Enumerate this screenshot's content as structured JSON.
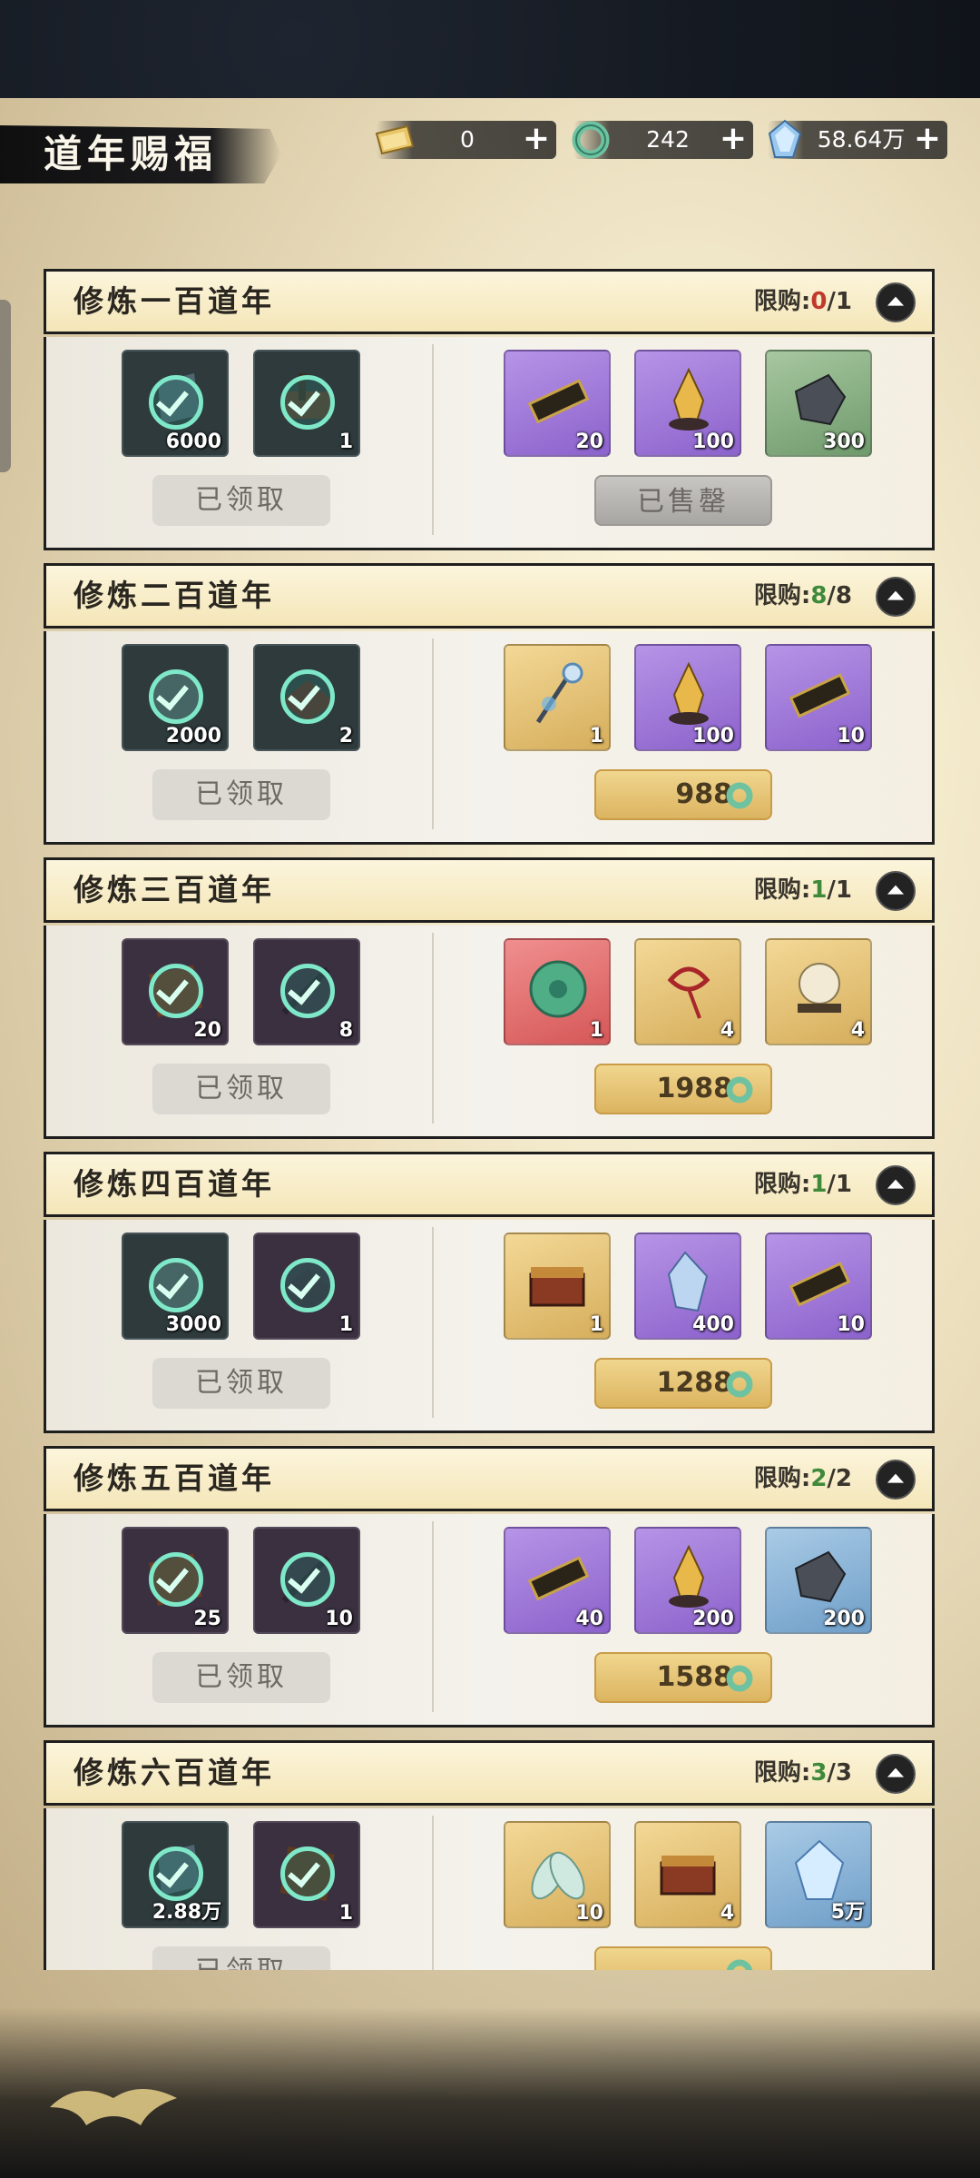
{
  "header": {
    "title": "道年赐福",
    "currencies": [
      {
        "icon": "ticket-icon",
        "value": "0"
      },
      {
        "icon": "jade-ring-icon",
        "value": "242"
      },
      {
        "icon": "spirit-crystal-icon",
        "value": "58.64万"
      }
    ]
  },
  "labels": {
    "claimed": "已领取",
    "sold_out": "已售罄",
    "limit_prefix": "限购:"
  },
  "cards": [
    {
      "title": "修炼一百道年",
      "limit_bought": "0",
      "limit_total": "1",
      "free": [
        {
          "icon": "crystal-shard-icon",
          "qty": "6000"
        },
        {
          "icon": "treasure-pile-icon",
          "qty": "1"
        }
      ],
      "paid": [
        {
          "icon": "jade-token-icon",
          "qty": "20",
          "rarity": "purple"
        },
        {
          "icon": "golden-crystal-icon",
          "qty": "100",
          "rarity": "purple"
        },
        {
          "icon": "ore-stone-icon",
          "qty": "300",
          "rarity": "green"
        }
      ],
      "price": null,
      "sold_out": true
    },
    {
      "title": "修炼二百道年",
      "limit_bought": "8",
      "limit_total": "8",
      "free": [
        {
          "icon": "rock-ore-icon",
          "qty": "2000"
        },
        {
          "icon": "green-gem-icon",
          "qty": "2"
        }
      ],
      "paid": [
        {
          "icon": "spirit-staff-icon",
          "qty": "1",
          "rarity": "gold"
        },
        {
          "icon": "golden-crystal-icon",
          "qty": "100",
          "rarity": "purple"
        },
        {
          "icon": "jade-token-icon",
          "qty": "10",
          "rarity": "purple"
        }
      ],
      "price": "988",
      "sold_out": false
    },
    {
      "title": "修炼三百道年",
      "limit_bought": "1",
      "limit_total": "1",
      "free": [
        {
          "icon": "scroll-book-icon",
          "qty": "20"
        },
        {
          "icon": "brush-icon",
          "qty": "8"
        }
      ],
      "paid": [
        {
          "icon": "jade-disc-icon",
          "qty": "1",
          "rarity": "red"
        },
        {
          "icon": "red-cord-icon",
          "qty": "4",
          "rarity": "gold"
        },
        {
          "icon": "pearl-orb-icon",
          "qty": "4",
          "rarity": "gold"
        }
      ],
      "price": "1988",
      "sold_out": false
    },
    {
      "title": "修炼四百道年",
      "limit_bought": "1",
      "limit_total": "1",
      "free": [
        {
          "icon": "rock-ore-icon",
          "qty": "3000"
        },
        {
          "icon": "green-gem-icon",
          "qty": "1"
        }
      ],
      "paid": [
        {
          "icon": "treasure-chest-icon",
          "qty": "1",
          "rarity": "gold"
        },
        {
          "icon": "blue-crystal-icon",
          "qty": "400",
          "rarity": "purple"
        },
        {
          "icon": "jade-token-icon",
          "qty": "10",
          "rarity": "purple"
        }
      ],
      "price": "1288",
      "sold_out": false
    },
    {
      "title": "修炼五百道年",
      "limit_bought": "2",
      "limit_total": "2",
      "free": [
        {
          "icon": "scroll-book-icon",
          "qty": "25"
        },
        {
          "icon": "brush-icon",
          "qty": "10"
        }
      ],
      "paid": [
        {
          "icon": "jade-token-icon",
          "qty": "40",
          "rarity": "purple"
        },
        {
          "icon": "golden-crystal-icon",
          "qty": "200",
          "rarity": "purple"
        },
        {
          "icon": "ore-stone-icon",
          "qty": "200",
          "rarity": "blue"
        }
      ],
      "price": "1588",
      "sold_out": false
    },
    {
      "title": "修炼六百道年",
      "limit_bought": "3",
      "limit_total": "3",
      "free": [
        {
          "icon": "crystal-shard-icon",
          "qty": "2.88万"
        },
        {
          "icon": "wooden-box-icon",
          "qty": "1"
        }
      ],
      "paid": [
        {
          "icon": "cicada-wing-icon",
          "qty": "10",
          "rarity": "gold"
        },
        {
          "icon": "treasure-chest-icon",
          "qty": "4",
          "rarity": "gold"
        },
        {
          "icon": "spirit-crystal-icon",
          "qty": "5万",
          "rarity": "blue"
        }
      ],
      "price": null,
      "sold_out": false
    }
  ]
}
